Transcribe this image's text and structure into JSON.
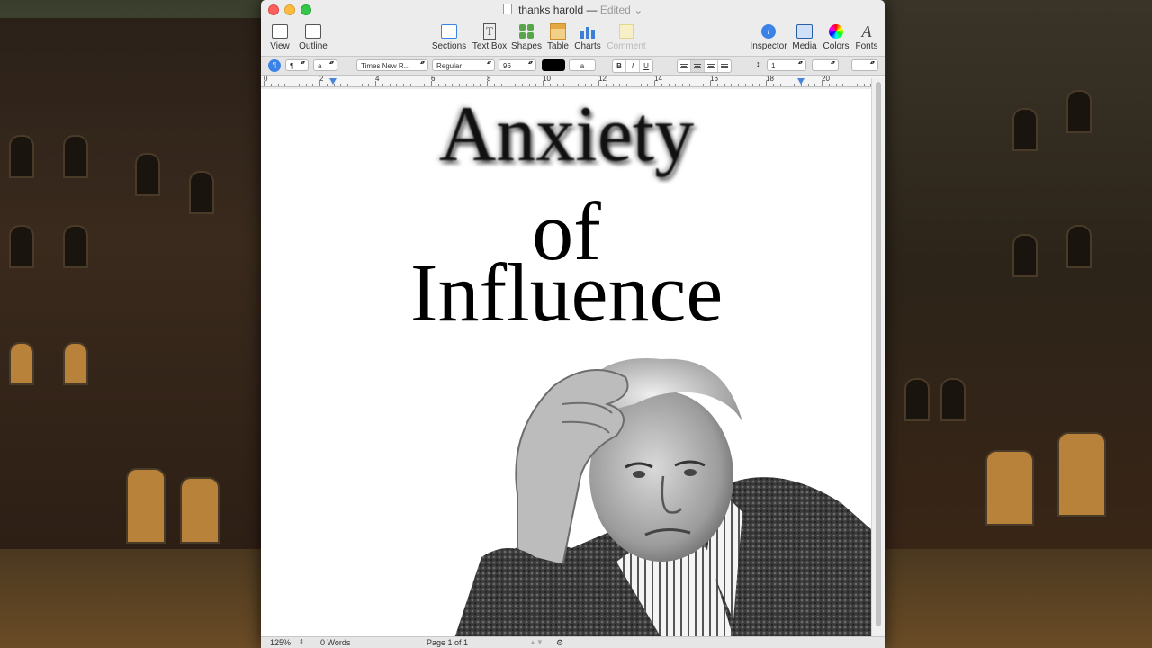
{
  "window": {
    "title": "thanks harold",
    "separator": "—",
    "status": "Edited"
  },
  "toolbar": {
    "left": [
      {
        "label": "View",
        "icon": "view-icon"
      },
      {
        "label": "Outline",
        "icon": "outline-icon"
      }
    ],
    "center": [
      {
        "label": "Sections",
        "icon": "sections-icon"
      },
      {
        "label": "Text Box",
        "icon": "text-box-icon"
      },
      {
        "label": "Shapes",
        "icon": "shapes-icon"
      },
      {
        "label": "Table",
        "icon": "table-icon"
      },
      {
        "label": "Charts",
        "icon": "charts-icon"
      },
      {
        "label": "Comment",
        "icon": "comment-icon",
        "disabled": true
      }
    ],
    "right": [
      {
        "label": "Inspector",
        "icon": "inspector-icon"
      },
      {
        "label": "Media",
        "icon": "media-icon"
      },
      {
        "label": "Colors",
        "icon": "colors-icon"
      },
      {
        "label": "Fonts",
        "icon": "fonts-icon"
      }
    ]
  },
  "format_bar": {
    "paragraph_style": "¶",
    "character_style": "a",
    "font_family": "Times New R...",
    "font_typeface": "Regular",
    "font_size": "96",
    "text_color": "#000000",
    "highlight_label": "a",
    "bold": "B",
    "italic": "I",
    "underline": "U",
    "line_spacing": "1"
  },
  "ruler": {
    "numbers": [
      "0",
      "2",
      "4",
      "6",
      "8",
      "10",
      "12",
      "14",
      "16",
      "18",
      "20"
    ]
  },
  "document": {
    "title_line1": "Anxiety",
    "title_line2": "of",
    "title_line3": "Influence"
  },
  "status_bar": {
    "zoom": "125%",
    "word_count": "0 Words",
    "page": "Page 1 of 1"
  },
  "colors": {
    "accent": "#3b82e8",
    "close": "#fc605c",
    "minimize": "#fdbc40",
    "zoom": "#34c84a"
  }
}
